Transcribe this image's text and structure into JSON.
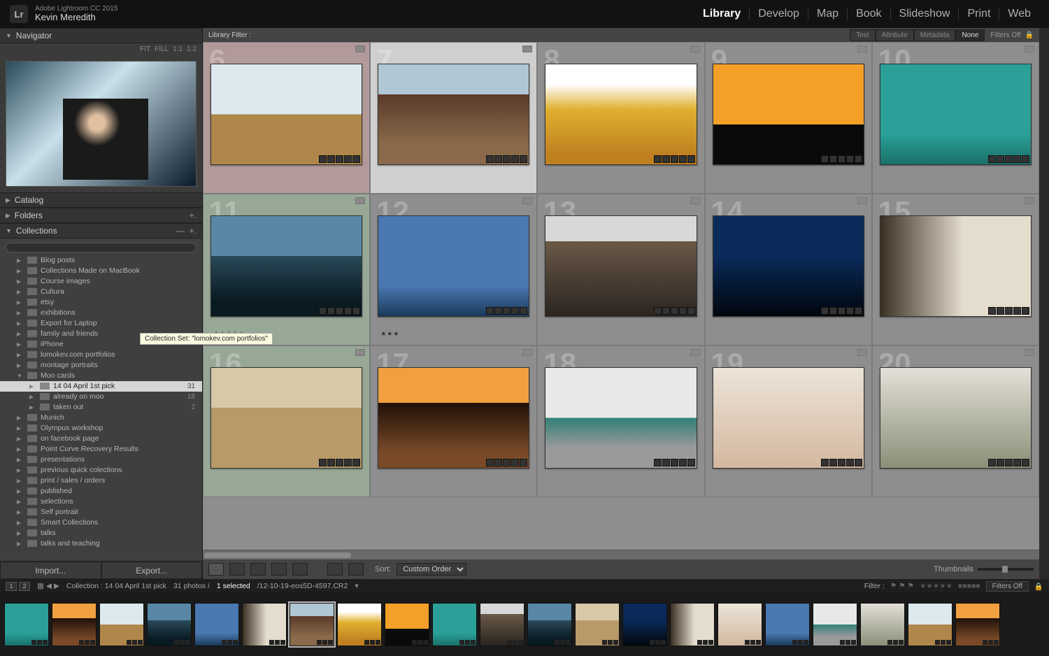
{
  "app": {
    "product": "Adobe Lightroom CC 2015",
    "user": "Kevin Meredith",
    "logo": "Lr"
  },
  "modules": [
    "Library",
    "Develop",
    "Map",
    "Book",
    "Slideshow",
    "Print",
    "Web"
  ],
  "active_module": "Library",
  "left": {
    "navigator": {
      "title": "Navigator",
      "sizes": [
        "FIT",
        "FILL",
        "1:1",
        "1:2"
      ]
    },
    "catalog": {
      "title": "Catalog"
    },
    "folders": {
      "title": "Folders"
    },
    "collections": {
      "title": "Collections",
      "filter_placeholder": "",
      "tooltip": "Collection Set: \"lomokev.com portfolios\"",
      "items": [
        {
          "name": "Blog posts",
          "indent": 1
        },
        {
          "name": "Collections Made on MacBook",
          "indent": 1
        },
        {
          "name": "Course images",
          "indent": 1
        },
        {
          "name": "Cultura",
          "indent": 1
        },
        {
          "name": "etsy",
          "indent": 1
        },
        {
          "name": "exhibitions",
          "indent": 1
        },
        {
          "name": "Export for Laptop",
          "indent": 1
        },
        {
          "name": "family and friends",
          "indent": 1
        },
        {
          "name": "iPhone",
          "indent": 1
        },
        {
          "name": "lomokev.com portfolios",
          "indent": 1
        },
        {
          "name": "montage portraits",
          "indent": 1
        },
        {
          "name": "Moo cards",
          "indent": 1,
          "expanded": true
        },
        {
          "name": "14 04 April 1st pick",
          "indent": 2,
          "count": "31",
          "selected": true
        },
        {
          "name": "already on moo",
          "indent": 2,
          "count": "18"
        },
        {
          "name": "taken out",
          "indent": 2,
          "count": "2"
        },
        {
          "name": "Munich",
          "indent": 1
        },
        {
          "name": "Olympus workshop",
          "indent": 1
        },
        {
          "name": "on facebook page",
          "indent": 1
        },
        {
          "name": "Point Curve Recovery Results",
          "indent": 1
        },
        {
          "name": "presentations",
          "indent": 1
        },
        {
          "name": "previous quick colections",
          "indent": 1
        },
        {
          "name": "print / sales / orders",
          "indent": 1
        },
        {
          "name": "published",
          "indent": 1
        },
        {
          "name": "selections",
          "indent": 1
        },
        {
          "name": "Self portrait",
          "indent": 1
        },
        {
          "name": "Smart Collections",
          "indent": 1
        },
        {
          "name": "talks",
          "indent": 1
        },
        {
          "name": "talks and teaching",
          "indent": 1
        }
      ]
    },
    "buttons": {
      "import": "Import...",
      "export": "Export..."
    }
  },
  "filter": {
    "label": "Library Filter :",
    "tabs": [
      "Text",
      "Attribute",
      "Metadata",
      "None"
    ],
    "selected": "None",
    "off": "Filters Off"
  },
  "grid": {
    "cells": [
      {
        "n": "6",
        "tint": "pink",
        "ph": "ph0",
        "stars": 0,
        "dot": true
      },
      {
        "n": "7",
        "tint": "sel",
        "ph": "ph1"
      },
      {
        "n": "8",
        "ph": "ph2"
      },
      {
        "n": "9",
        "ph": "ph3"
      },
      {
        "n": "10",
        "ph": "ph4"
      },
      {
        "n": "11",
        "tint": "green",
        "ph": "ph5",
        "stars": 5
      },
      {
        "n": "12",
        "ph": "ph6",
        "stars": 3
      },
      {
        "n": "13",
        "ph": "ph7"
      },
      {
        "n": "14",
        "ph": "ph8"
      },
      {
        "n": "15",
        "ph": "ph9"
      },
      {
        "n": "16",
        "tint": "green",
        "ph": "ph10"
      },
      {
        "n": "17",
        "ph": "ph11"
      },
      {
        "n": "18",
        "ph": "ph12"
      },
      {
        "n": "19",
        "ph": "ph13"
      },
      {
        "n": "20",
        "ph": "ph14"
      }
    ]
  },
  "toolbar": {
    "sort_label": "Sort:",
    "sort_value": "Custom Order",
    "thumbnails": "Thumbnails"
  },
  "info": {
    "pages": [
      "1",
      "2"
    ],
    "collection_path": "Collection : 14 04 April 1st pick",
    "count": "31 photos /",
    "selected": "1 selected",
    "filename": "/12-10-19-eos5D-4597.CR2",
    "filter_label": "Filter :",
    "filters_off": "Filters Off"
  },
  "filmstrip": {
    "count": 21,
    "selected": 6
  }
}
